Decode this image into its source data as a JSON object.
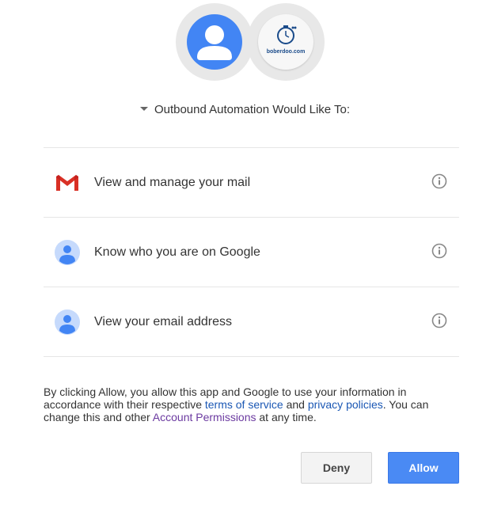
{
  "avatars": {
    "app_logo_text": "boberdoo.com"
  },
  "heading": "Outbound Automation Would Like To:",
  "scopes": [
    {
      "label": "View and manage your mail",
      "icon": "gmail-icon"
    },
    {
      "label": "Know who you are on Google",
      "icon": "google-profile-icon"
    },
    {
      "label": "View your email address",
      "icon": "google-profile-icon"
    }
  ],
  "disclaimer": {
    "part1": "By clicking Allow, you allow this app and Google to use your information in accordance with their respective ",
    "terms_link": "terms of service",
    "part2": " and ",
    "privacy_link": "privacy policies",
    "part3": ". You can change this and other ",
    "permissions_link": "Account Permissions",
    "part4": " at any time."
  },
  "buttons": {
    "deny": "Deny",
    "allow": "Allow"
  },
  "colors": {
    "accent": "#4a8af4",
    "link": "#1a57b4",
    "visited_link": "#6b3aa0"
  }
}
